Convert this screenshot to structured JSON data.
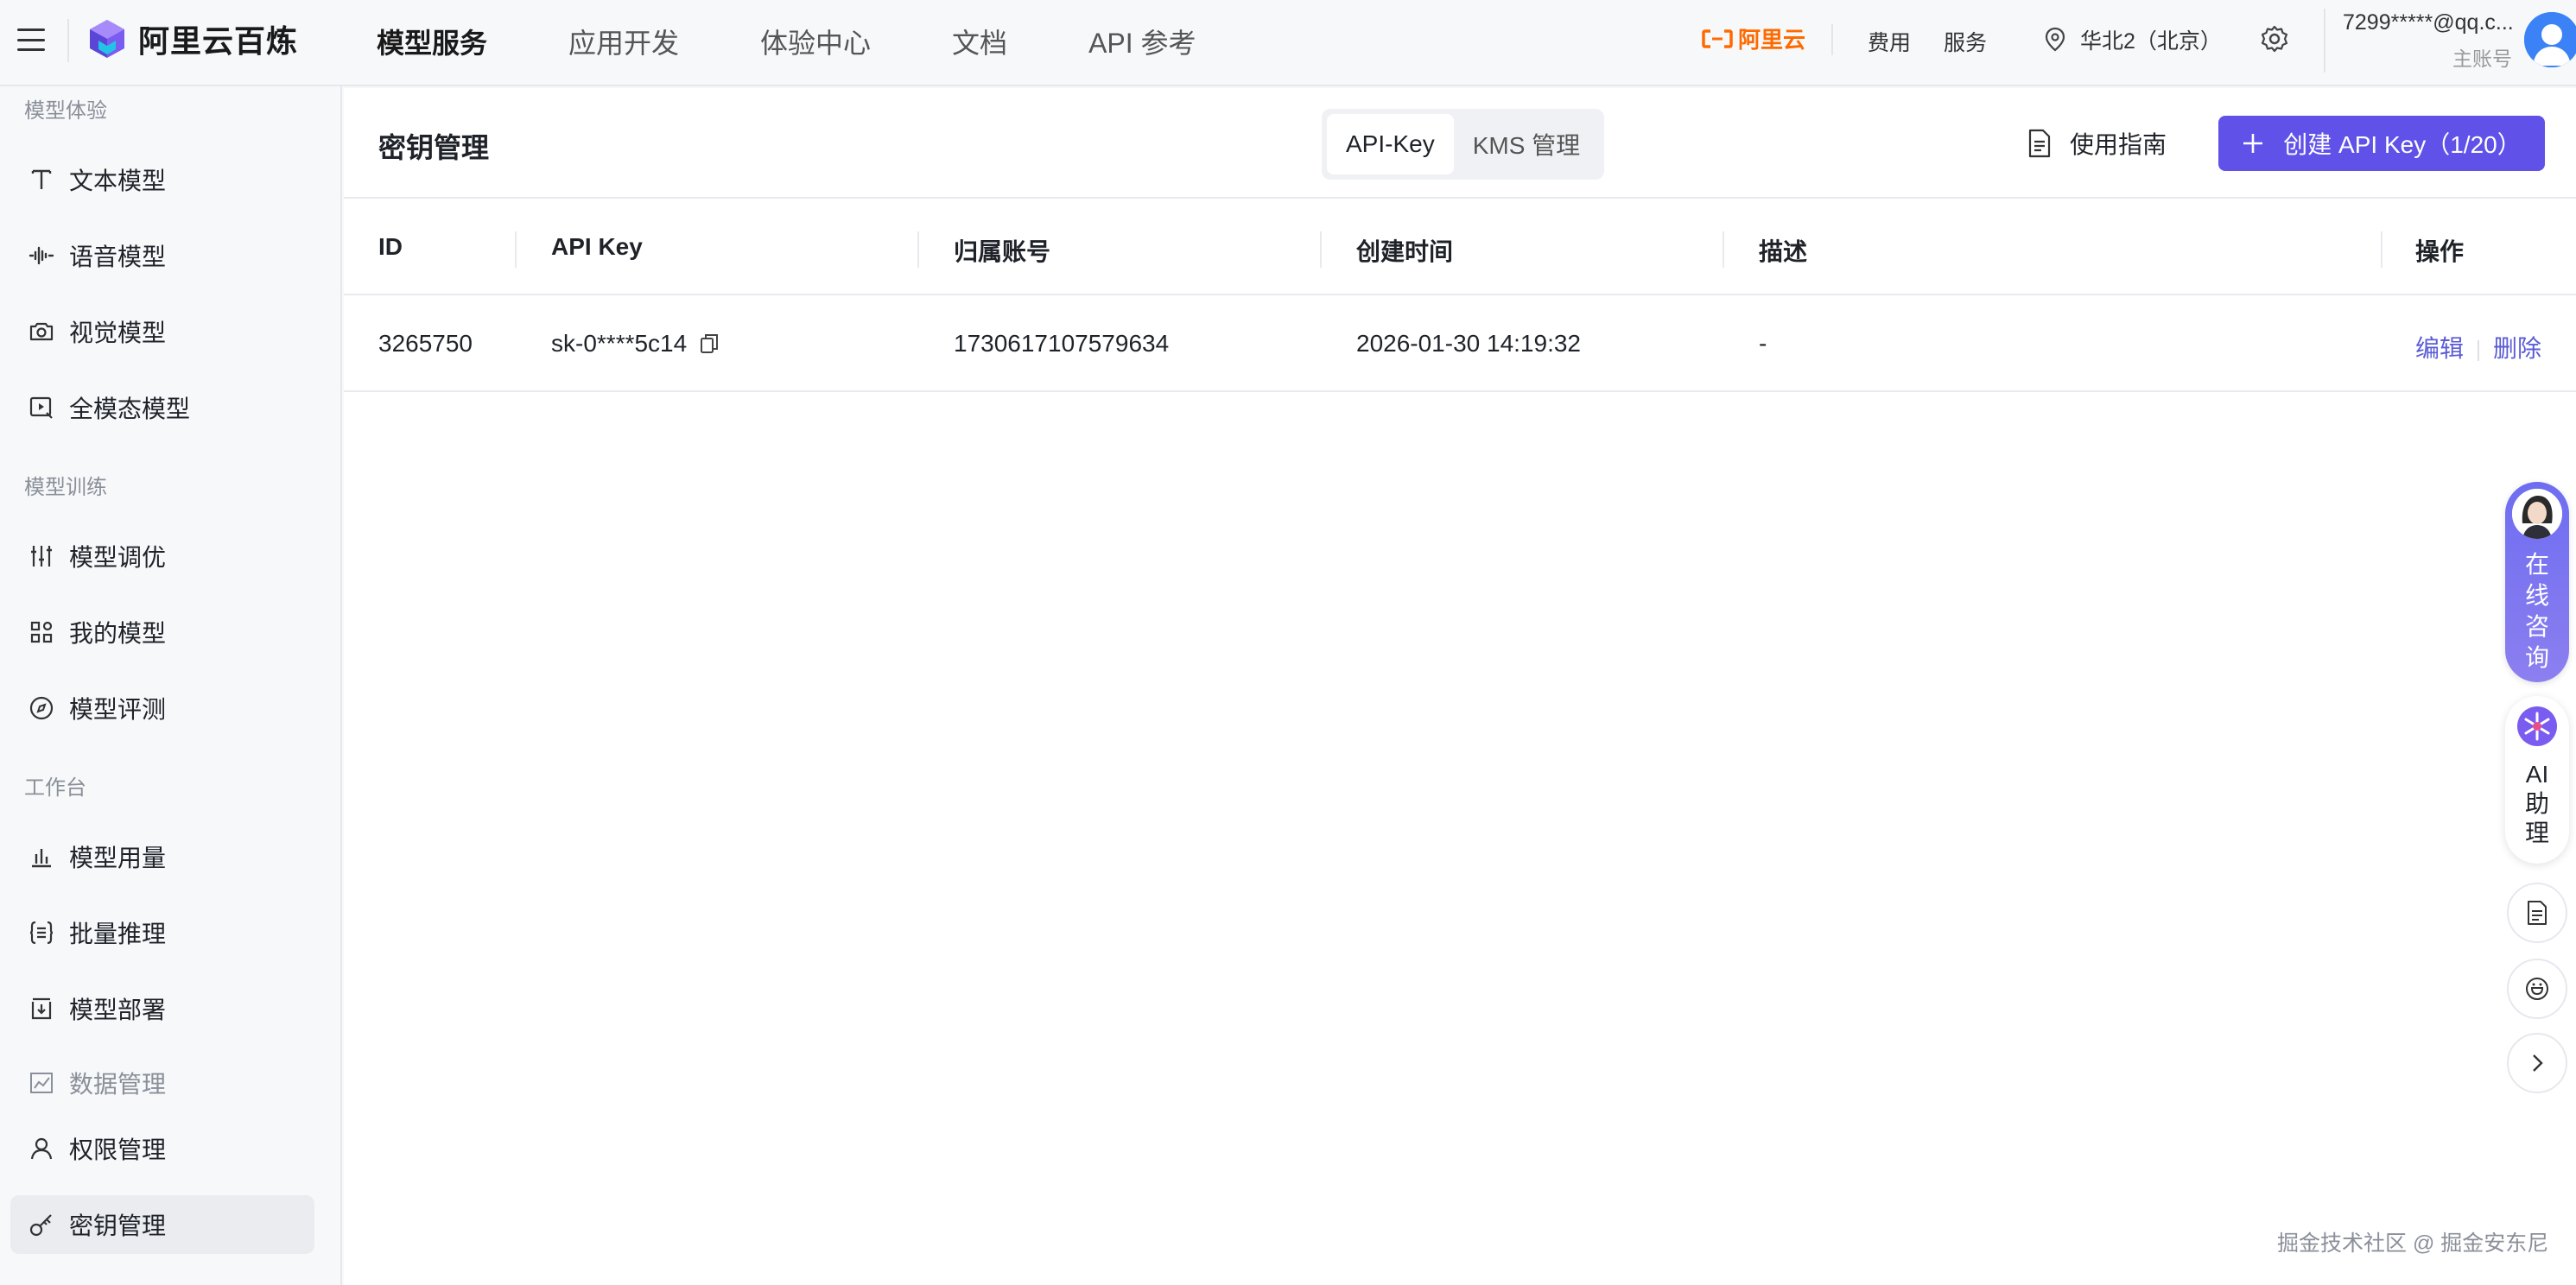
{
  "header": {
    "brand": "阿里云百炼",
    "nav": [
      {
        "label": "模型服务",
        "active": true
      },
      {
        "label": "应用开发",
        "active": false
      },
      {
        "label": "体验中心",
        "active": false
      },
      {
        "label": "文档",
        "active": false
      },
      {
        "label": "API 参考",
        "active": false
      }
    ],
    "aliyun_label": "阿里云",
    "fees": "费用",
    "service": "服务",
    "region": "华北2（北京）",
    "account": "7299*****@qq.c...",
    "account_role": "主账号"
  },
  "sidebar": {
    "groups": {
      "experience": "模型体验",
      "training": "模型训练",
      "workbench": "工作台"
    },
    "items": [
      {
        "label": "文本模型",
        "icon": "text-t-icon"
      },
      {
        "label": "语音模型",
        "icon": "audio-wave-icon"
      },
      {
        "label": "视觉模型",
        "icon": "camera-icon"
      },
      {
        "label": "全模态模型",
        "icon": "omni-play-icon"
      },
      {
        "label": "模型调优",
        "icon": "sliders-icon"
      },
      {
        "label": "我的模型",
        "icon": "grid-shapes-icon"
      },
      {
        "label": "模型评测",
        "icon": "compass-icon"
      },
      {
        "label": "模型用量",
        "icon": "bar-chart-icon"
      },
      {
        "label": "批量推理",
        "icon": "braces-list-icon"
      },
      {
        "label": "模型部署",
        "icon": "deploy-box-icon"
      },
      {
        "label": "数据管理",
        "icon": "line-chart-icon"
      },
      {
        "label": "权限管理",
        "icon": "user-icon"
      },
      {
        "label": "密钥管理",
        "icon": "key-icon"
      }
    ]
  },
  "page": {
    "title": "密钥管理",
    "tabs": [
      {
        "label": "API-Key",
        "active": true
      },
      {
        "label": "KMS 管理",
        "active": false
      }
    ],
    "guide_label": "使用指南",
    "create_label": "创建 API Key（1/20）"
  },
  "table": {
    "columns": [
      "ID",
      "API Key",
      "归属账号",
      "创建时间",
      "描述",
      "操作"
    ],
    "rows": [
      {
        "id": "3265750",
        "api_key": "sk-0****5c14",
        "account": "1730617107579634",
        "created": "2026-01-30 14:19:32",
        "desc": "-",
        "edit": "编辑",
        "delete": "删除"
      }
    ]
  },
  "float": {
    "consult": [
      "在",
      "线",
      "咨",
      "询"
    ],
    "ai": [
      "AI",
      "助",
      "理"
    ]
  },
  "watermark": "掘金技术社区 @ 掘金安东尼",
  "colors": {
    "primary": "#6052e8",
    "link": "#5b5bd6",
    "aliyun_orange": "#ff6a00"
  }
}
